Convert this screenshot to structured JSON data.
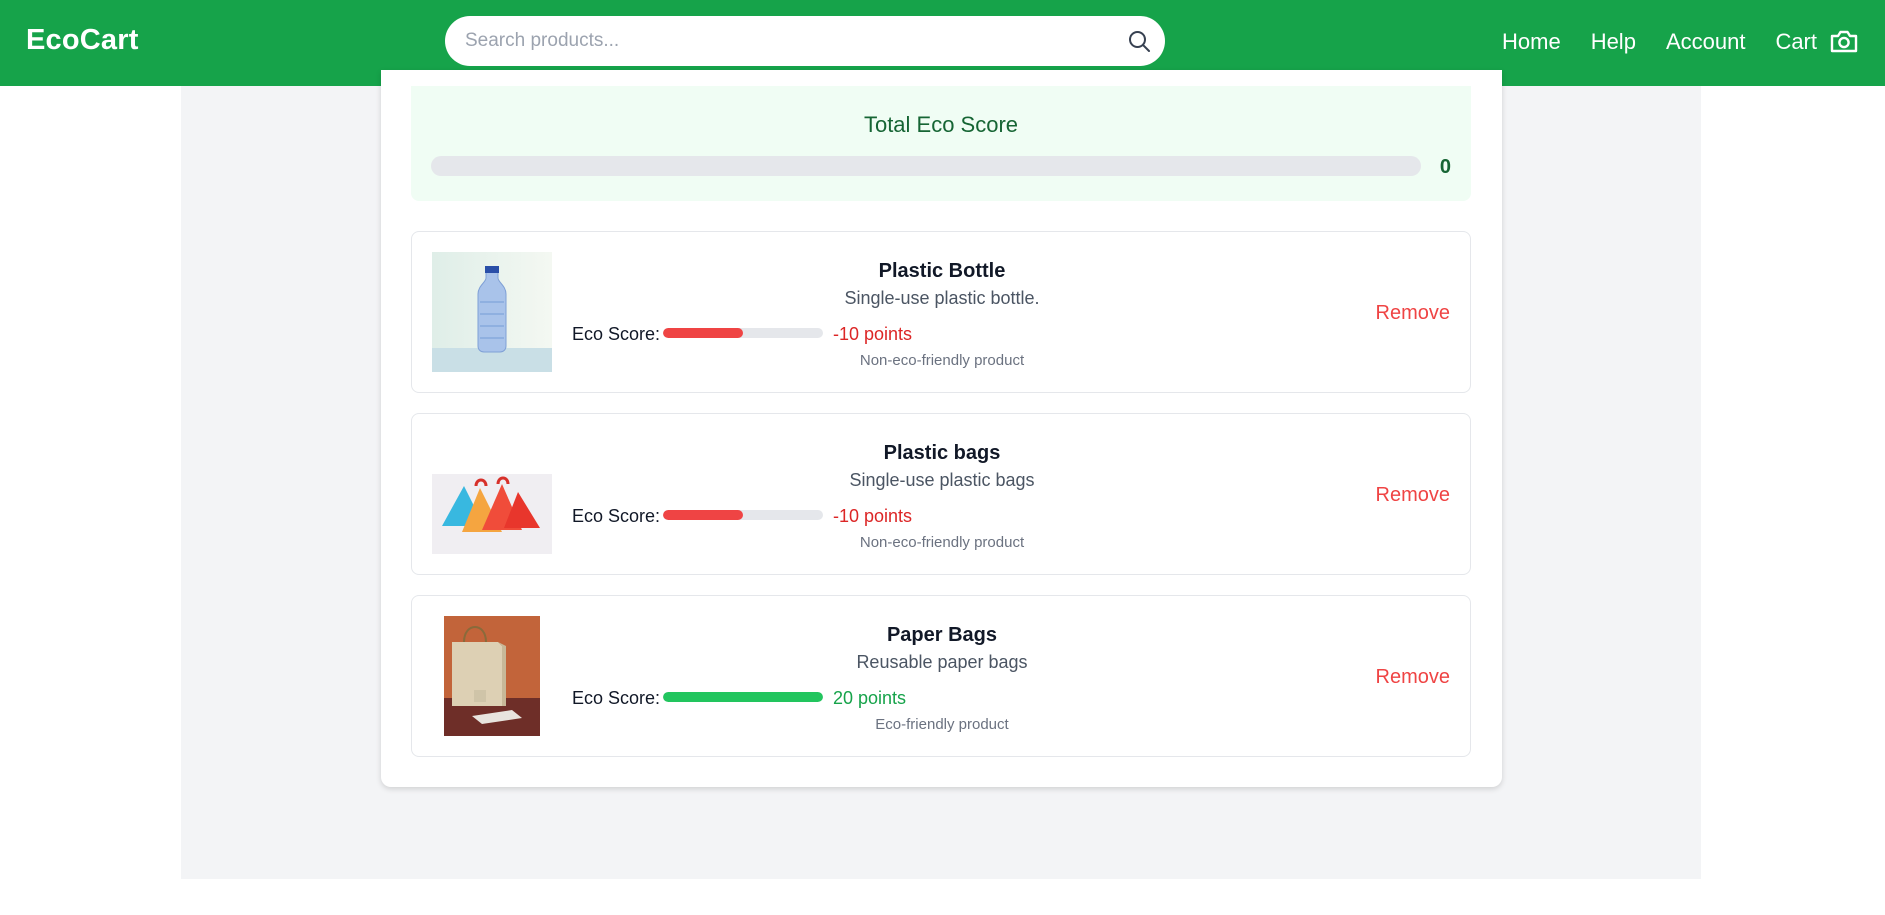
{
  "header": {
    "logo": "EcoCart",
    "search_placeholder": "Search products...",
    "nav": [
      "Home",
      "Help",
      "Account",
      "Cart"
    ]
  },
  "score": {
    "title": "Total Eco Score",
    "value": "0",
    "fill_fraction": 0
  },
  "items": [
    {
      "name": "Plastic Bottle",
      "description": "Single-use plastic bottle.",
      "eco_label": "Eco Score:",
      "points": "-10 points",
      "fill_fraction": 0.5,
      "color": "#ef4444",
      "text_color": "#dc2626",
      "note": "Non-eco-friendly product",
      "remove": "Remove",
      "image_icon": "plastic-bottle-image"
    },
    {
      "name": "Plastic bags",
      "description": "Single-use plastic bags",
      "eco_label": "Eco Score:",
      "points": "-10 points",
      "fill_fraction": 0.5,
      "color": "#ef4444",
      "text_color": "#dc2626",
      "note": "Non-eco-friendly product",
      "remove": "Remove",
      "image_icon": "plastic-bags-image"
    },
    {
      "name": "Paper Bags",
      "description": "Reusable paper bags",
      "eco_label": "Eco Score:",
      "points": "20 points",
      "fill_fraction": 1.0,
      "color": "#22c55e",
      "text_color": "#16a34a",
      "note": "Eco-friendly product",
      "remove": "Remove",
      "image_icon": "paper-bag-image"
    }
  ]
}
